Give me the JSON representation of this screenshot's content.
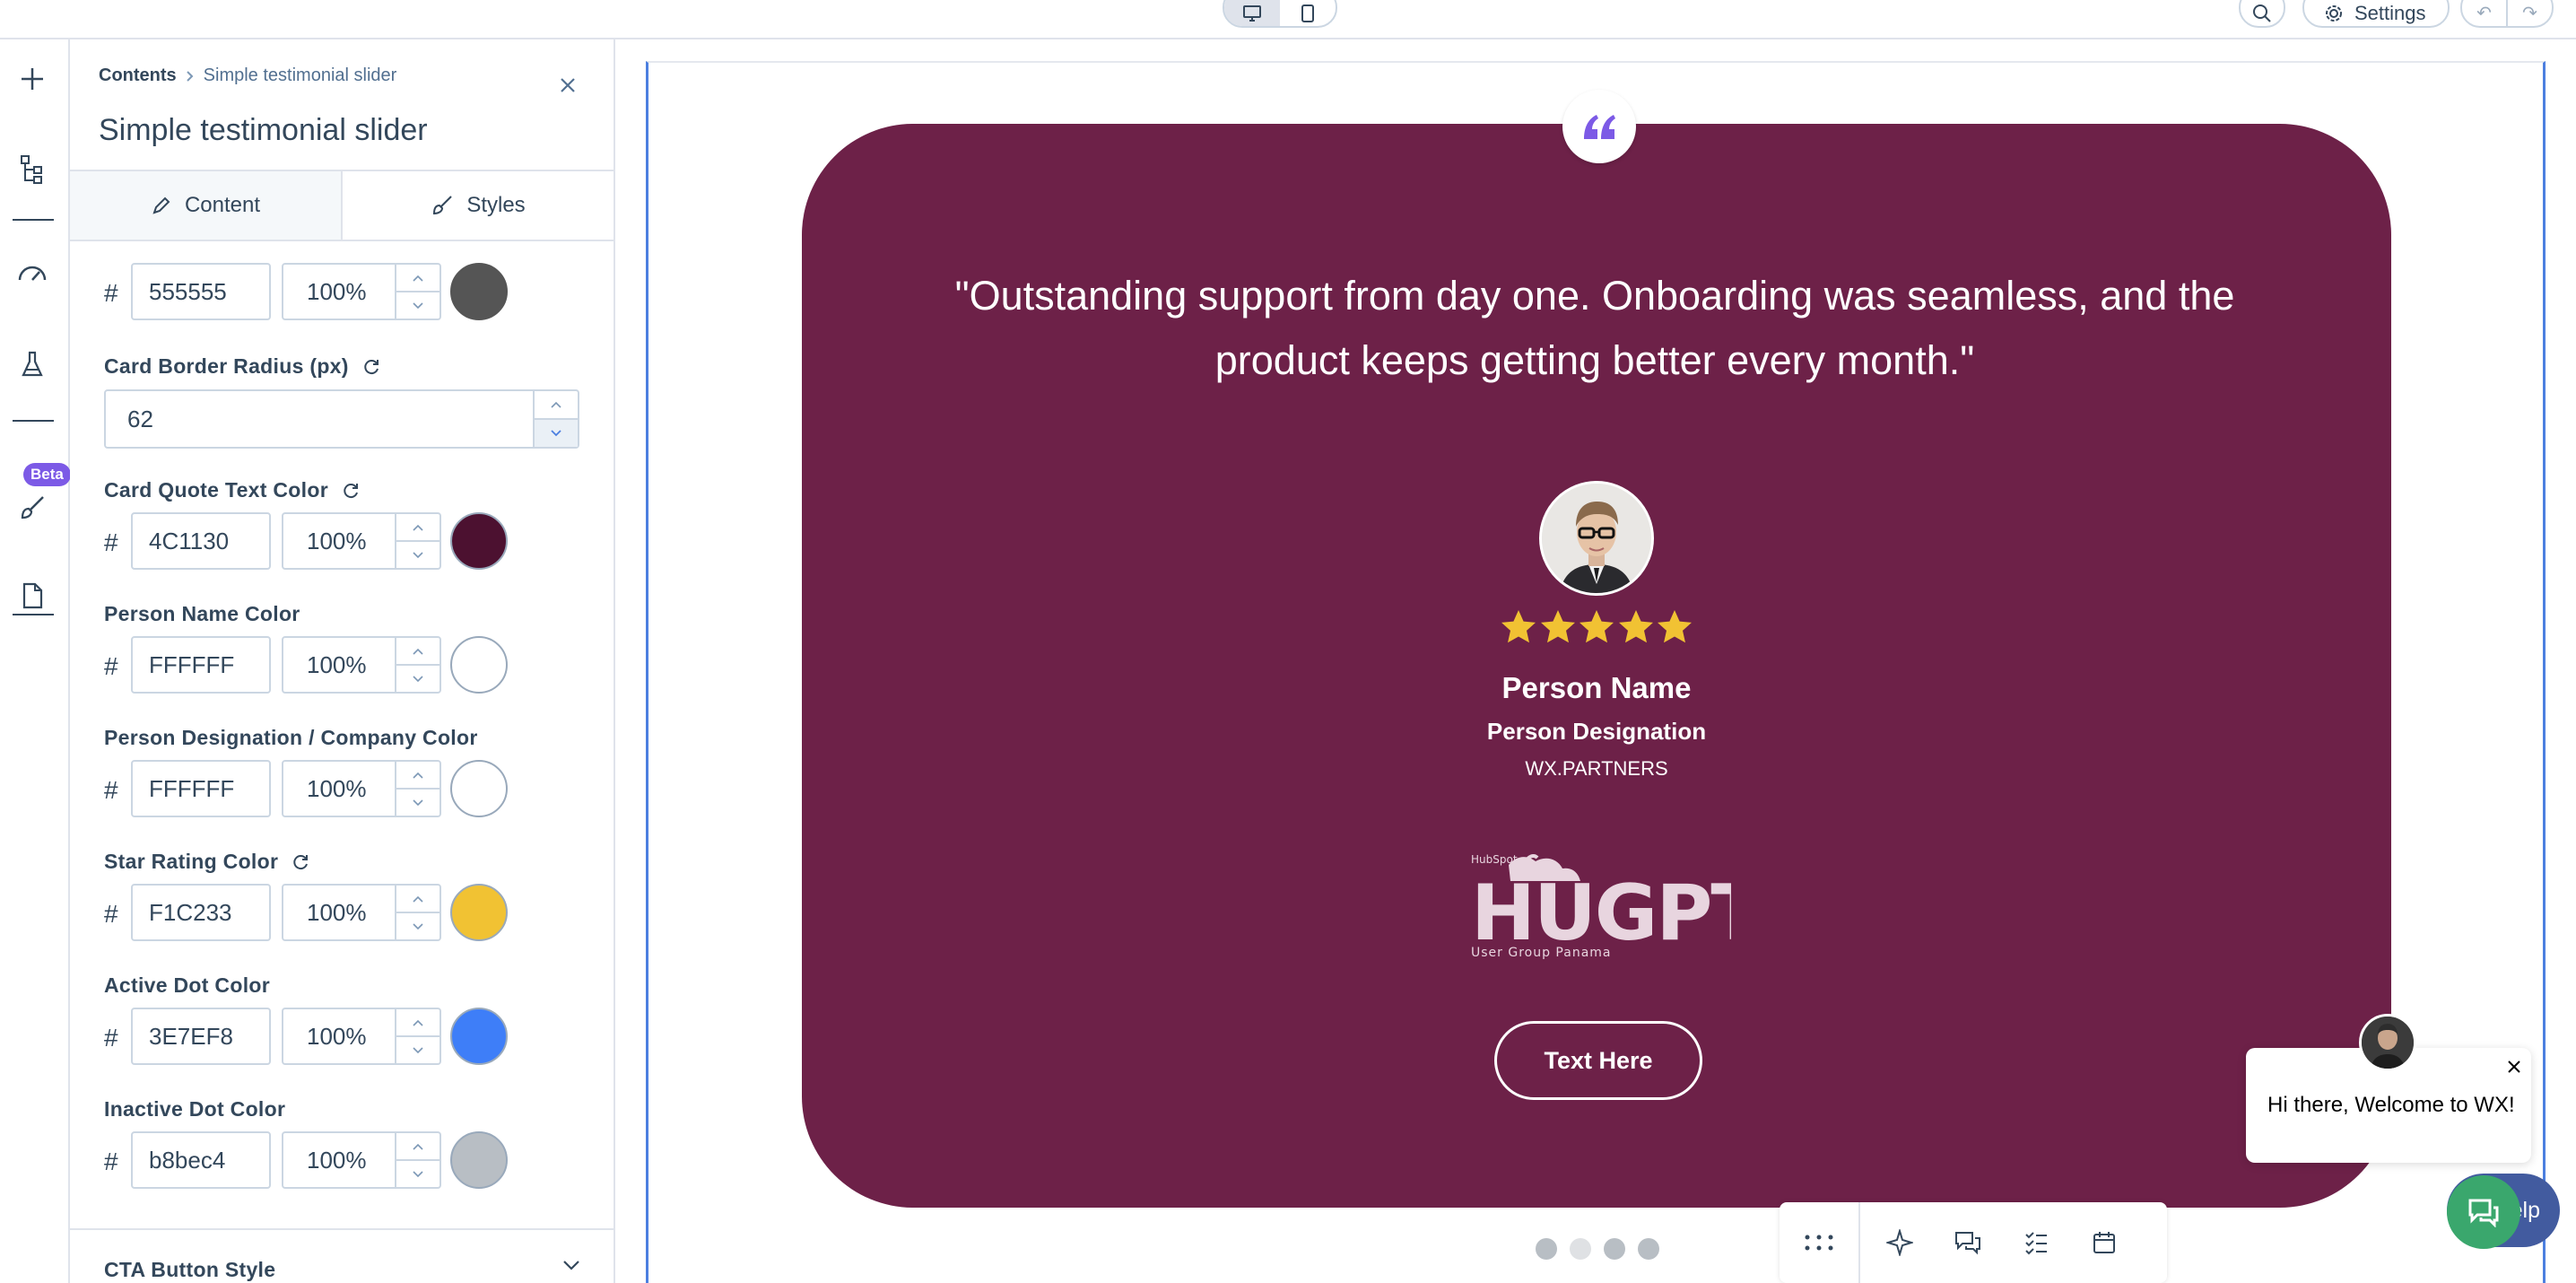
{
  "topbar": {
    "settings_label": "Settings",
    "undo_label": "↶",
    "redo_label": "↷"
  },
  "rail": {
    "beta_label": "Beta"
  },
  "panel": {
    "breadcrumb_root": "Contents",
    "breadcrumb_current": "Simple testimonial slider",
    "title": "Simple testimonial slider",
    "tab_content": "Content",
    "tab_styles": "Styles",
    "partial_row": {
      "hex": "555555",
      "opacity": "100%",
      "swatch": "#555555"
    },
    "card_border_radius": {
      "label": "Card Border Radius (px)",
      "value": "62"
    },
    "colors": [
      {
        "label": "Card Quote Text Color",
        "hex": "4C1130",
        "opacity": "100%",
        "swatch": "#4C1130",
        "reset": true
      },
      {
        "label": "Person Name Color",
        "hex": "FFFFFF",
        "opacity": "100%",
        "swatch": "#FFFFFF",
        "reset": false
      },
      {
        "label": "Person Designation / Company Color",
        "hex": "FFFFFF",
        "opacity": "100%",
        "swatch": "#FFFFFF",
        "reset": false
      },
      {
        "label": "Star Rating Color",
        "hex": "F1C233",
        "opacity": "100%",
        "swatch": "#F1C233",
        "reset": true
      },
      {
        "label": "Active Dot Color",
        "hex": "3E7EF8",
        "opacity": "100%",
        "swatch": "#3E7EF8",
        "reset": false
      },
      {
        "label": "Inactive Dot Color",
        "hex": "b8bec4",
        "opacity": "100%",
        "swatch": "#b8bec4",
        "reset": false
      }
    ],
    "cta_section": "CTA Button Style"
  },
  "testimonial": {
    "quote": "\"Outstanding support from day one. Onboarding was seamless, and the product keeps getting better every month.\"",
    "person_name": "Person Name",
    "person_designation": "Person Designation",
    "company": "WX.PARTNERS",
    "logo_text": "HUGPTY",
    "logo_sub": "User Group Panama",
    "logo_top": "HubSpot",
    "cta_label": "Text Here",
    "rating": 5,
    "card_color": "#6d2148",
    "star_color": "#F1C233"
  },
  "chat": {
    "message": "Hi there, Welcome to WX!",
    "help_label": "Help"
  }
}
